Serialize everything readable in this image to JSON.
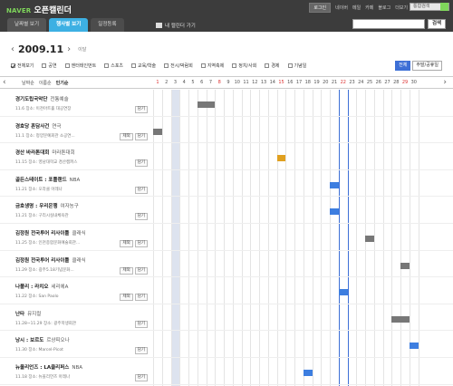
{
  "app": {
    "logo_brand": "NAVER",
    "logo_title": "오픈캘린더"
  },
  "gnb": {
    "login": "로그인",
    "links": [
      "네이버",
      "메일",
      "카페",
      "블로그",
      "더보기"
    ],
    "search_placeholder": "통합검색"
  },
  "tabs": [
    {
      "label": "날짜별 보기"
    },
    {
      "label": "행사별 보기"
    },
    {
      "label": "일정등록"
    }
  ],
  "goto_label": "내 캘린더 가기",
  "search_button": "검색",
  "month": {
    "label": "2009.11",
    "sub": "이달"
  },
  "filters": [
    {
      "label": "전체보기",
      "checked": true
    },
    {
      "label": "공연",
      "checked": false
    },
    {
      "label": "엔터테인먼트",
      "checked": false
    },
    {
      "label": "스포츠",
      "checked": false
    },
    {
      "label": "교육/학술",
      "checked": false
    },
    {
      "label": "전시/박람회",
      "checked": false
    },
    {
      "label": "지역축제",
      "checked": false
    },
    {
      "label": "정치/사회",
      "checked": false
    },
    {
      "label": "경제",
      "checked": false
    },
    {
      "label": "기념일",
      "checked": false
    }
  ],
  "view_buttons": [
    "전체",
    "주말/공휴일"
  ],
  "sort": [
    "날짜순",
    "이름순",
    "인기순"
  ],
  "days": [
    "1",
    "2",
    "3",
    "4",
    "5",
    "6",
    "7",
    "8",
    "9",
    "10",
    "11",
    "12",
    "13",
    "14",
    "15",
    "16",
    "17",
    "18",
    "19",
    "20",
    "21",
    "22",
    "23",
    "24",
    "25",
    "26",
    "27",
    "28",
    "29",
    "30"
  ],
  "red_days": [
    "1",
    "8",
    "15",
    "22",
    "29"
  ],
  "today": "3",
  "buttons": {
    "detail": "제외",
    "close": "담기"
  },
  "events": [
    {
      "title": "경기도립국악단",
      "cat": "전통예술",
      "sub": "11.6 장소: 이천아트홀 대공연장",
      "start": 6,
      "end": 7,
      "color": "#777777",
      "btns": [
        "close"
      ]
    },
    {
      "title": "경호당 혼담사건",
      "cat": "연극",
      "sub": "11.1 장소: 청양문예회관 소공연...",
      "start": 1,
      "end": 1,
      "color": "#777777",
      "btns": [
        "detail",
        "close"
      ]
    },
    {
      "title": "경산 바라톤대회",
      "cat": "마라톤대회",
      "sub": "11.15 장소: 영남대학교 경산캠퍼스",
      "start": 15,
      "end": 15,
      "color": "#e0a020",
      "btns": [
        "close"
      ]
    },
    {
      "title": "골든스테이트 : 포틀랜드",
      "cat": "NBA",
      "sub": "11.21 장소: 오라클 아레나",
      "start": 21,
      "end": 21,
      "color": "#3d7ee0",
      "btns": [
        "close"
      ]
    },
    {
      "title": "금호생명 : 우리은행",
      "cat": "여자농구",
      "sub": "11.21 장소: 구리시실내체육관",
      "start": 21,
      "end": 21,
      "color": "#3d7ee0",
      "btns": [
        "close"
      ]
    },
    {
      "title": "김정원 전국투어 리사이틀",
      "cat": "클래식",
      "sub": "11.25 장소: 인천종합문화예술회관...",
      "start": 25,
      "end": 25,
      "color": "#777777",
      "btns": [
        "detail",
        "close"
      ]
    },
    {
      "title": "김정원 전국투어 리사이틀",
      "cat": "클래식",
      "sub": "11.29 장소: 광주5.18기념문화...",
      "start": 29,
      "end": 29,
      "color": "#777777",
      "btns": [
        "detail",
        "close"
      ]
    },
    {
      "title": "나폴리 : 라치오",
      "cat": "세리에A",
      "sub": "11.22 장소: San Paolo",
      "start": 22,
      "end": 22,
      "color": "#3d7ee0",
      "btns": [
        "detail",
        "close"
      ]
    },
    {
      "title": "난타",
      "cat": "뮤지컬",
      "sub": "11.28~11.29 장소: 광주학생회관",
      "start": 28,
      "end": 29,
      "color": "#777777",
      "btns": [
        "close"
      ]
    },
    {
      "title": "낭시 : 보르도",
      "cat": "르샹피오나",
      "sub": "11.30 장소: Marcel-Picot",
      "start": 30,
      "end": 30,
      "color": "#3d7ee0",
      "btns": [
        "close"
      ]
    },
    {
      "title": "뉴올리언즈 : LA클리퍼스",
      "cat": "NBA",
      "sub": "11.18 장소: 뉴올리언즈 아레나",
      "start": 18,
      "end": 18,
      "color": "#3d7ee0",
      "btns": [
        "close"
      ]
    }
  ]
}
